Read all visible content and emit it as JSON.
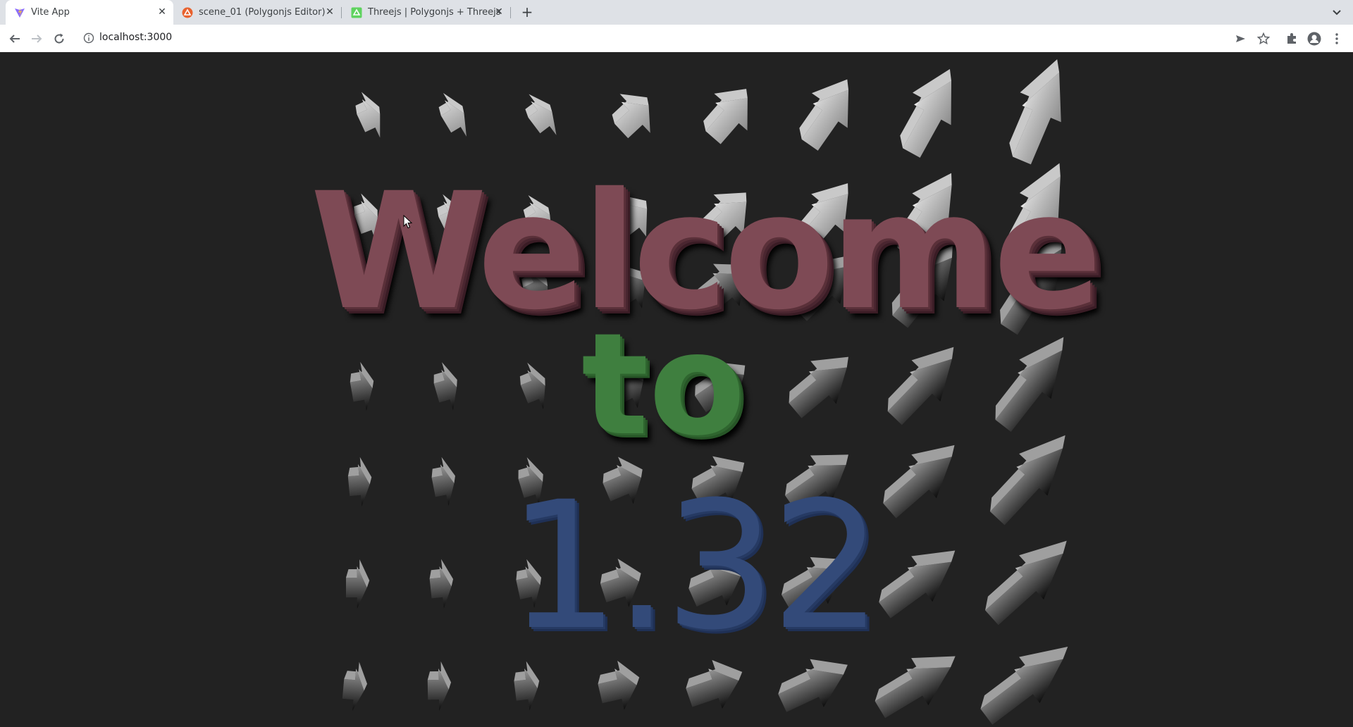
{
  "browser": {
    "tabs": [
      {
        "title": "Vite App",
        "active": true,
        "favicon": "vite-icon"
      },
      {
        "title": "scene_01 (Polygonjs Editor)",
        "active": false,
        "favicon": "polygonjs-icon"
      },
      {
        "title": "Threejs | Polygonjs + Threejs",
        "active": false,
        "favicon": "polygonjs-green-icon"
      }
    ],
    "url": "localhost:3000"
  },
  "scene": {
    "line1": "Welcome",
    "line2": "to",
    "line3": "1.32",
    "colors": {
      "welcome": "#7e4a55",
      "to": "#3f7f3f",
      "version": "#334a79",
      "background": "#222222"
    }
  }
}
